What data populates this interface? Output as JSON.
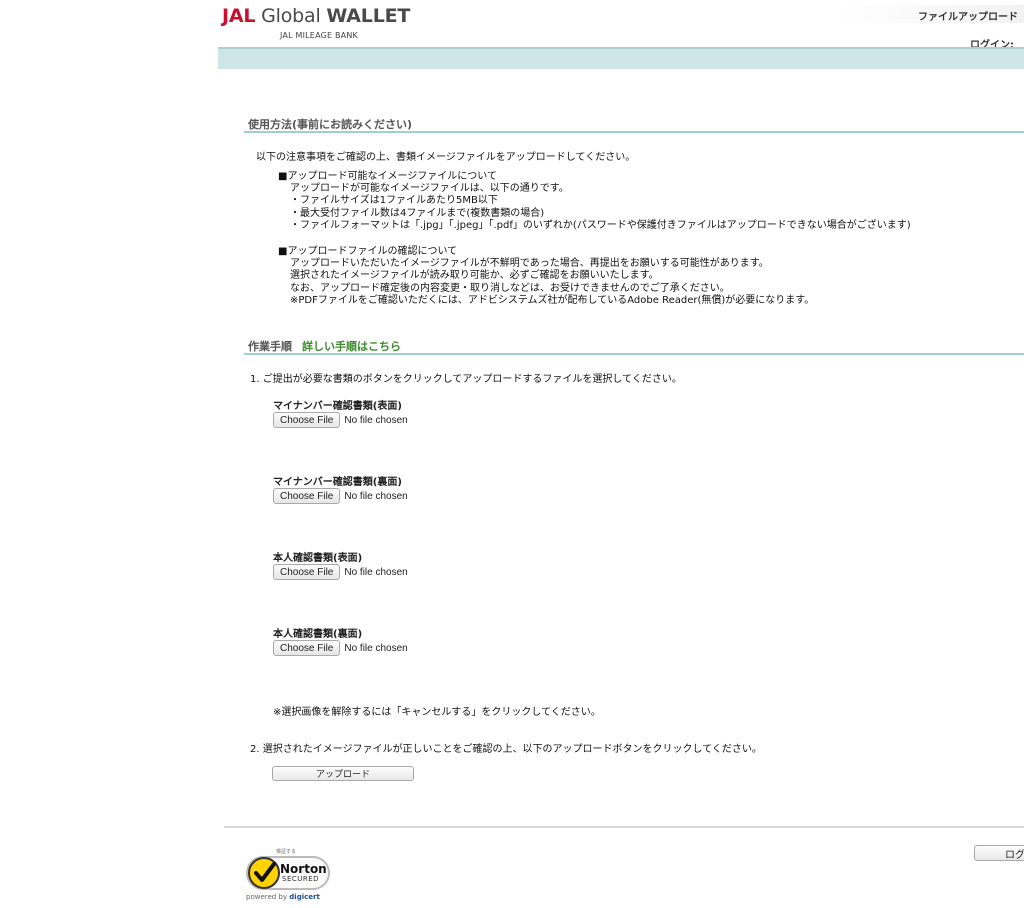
{
  "header": {
    "logo_jal": "JAL",
    "logo_global": "Global",
    "logo_wallet": "WALLET",
    "logo_sub": "JAL MILEAGE BANK",
    "page_title": "ファイルアップロード",
    "login_label": "ログイン:"
  },
  "usage": {
    "title": "使用方法(事前にお読みください)",
    "intro": "以下の注意事項をご確認の上、書類イメージファイルをアップロードしてください。",
    "upload_heading": "■アップロード可能なイメージファイルについて",
    "upload_lines": [
      "アップロードが可能なイメージファイルは、以下の通りです。",
      "・ファイルサイズは1ファイルあたり5MB以下",
      "・最大受付ファイル数は4ファイルまで(複数書類の場合)",
      "・ファイルフォーマットは「.jpg」「.jpeg」「.pdf」のいずれか(パスワードや保護付きファイルはアップロードできない場合がございます)"
    ],
    "confirm_heading": "■アップロードファイルの確認について",
    "confirm_lines": [
      "アップロードいただいたイメージファイルが不鮮明であった場合、再提出をお願いする可能性があります。",
      "選択されたイメージファイルが読み取り可能か、必ずご確認をお願いいたします。",
      "なお、アップロード確定後の内容変更・取り消しなどは、お受けできませんのでご了承ください。",
      "※PDFファイルをご確認いただくには、アドビシステムズ社が配布しているAdobe Reader(無償)が必要になります。"
    ]
  },
  "steps": {
    "title": "作業手順",
    "detail_link": "詳しい手順はこちら",
    "step1": "1. ご提出が必要な書類のボタンをクリックしてアップロードするファイルを選択してください。",
    "files": [
      {
        "label": "マイナンバー確認書類(表面)",
        "button": "Choose File",
        "status": "No file chosen"
      },
      {
        "label": "マイナンバー確認書類(裏面)",
        "button": "Choose File",
        "status": "No file chosen"
      },
      {
        "label": "本人確認書類(表面)",
        "button": "Choose File",
        "status": "No file chosen"
      },
      {
        "label": "本人確認書類(裏面)",
        "button": "Choose File",
        "status": "No file chosen"
      }
    ],
    "cancel_note": "※選択画像を解除するには「キャンセルする」をクリックしてください。",
    "step2": "2. 選択されたイメージファイルが正しいことをご確認の上、以下のアップロードボタンをクリックしてください。",
    "upload_button": "アップロード"
  },
  "footer": {
    "logout_button": "ログ",
    "norton_small": "検証する",
    "norton_name": "Norton",
    "norton_secured": "SECURED",
    "norton_powered": "powered by",
    "norton_digicert": "digicert"
  },
  "colors": {
    "brand_red": "#c8102e",
    "header_bar": "#cfe6e6",
    "section_rule": "#9fcfcf",
    "link_green": "#3b8a2c"
  }
}
